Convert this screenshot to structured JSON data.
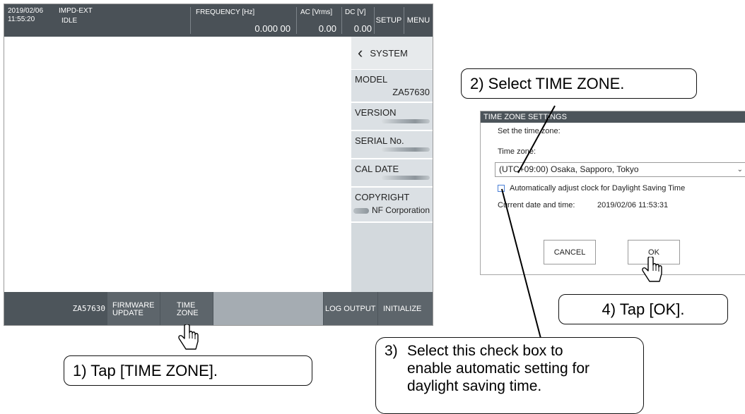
{
  "topbar": {
    "date": "2019/02/06",
    "time": "11:55:20",
    "mode": "IMPD-EXT",
    "status": "IDLE",
    "frequency_label": "FREQUENCY [Hz]",
    "frequency_value": "0.000 00",
    "ac_label": "AC [Vrms]",
    "ac_value": "0.00",
    "dc_label": "DC [V]",
    "dc_value": "0.00",
    "setup_label": "SETUP",
    "menu_label": "MENU"
  },
  "sidebar": {
    "back_icon": "‹",
    "title": "SYSTEM",
    "model_label": "MODEL",
    "model_value": "ZA57630",
    "version_label": "VERSION",
    "serial_label": "SERIAL No.",
    "cal_date_label": "CAL DATE",
    "copyright_label": "COPYRIGHT",
    "copyright_value": "NF Corporation"
  },
  "bottombar": {
    "model": "ZA57630",
    "firmware_update_l1": "FIRMWARE",
    "firmware_update_l2": "UPDATE",
    "time_zone_l1": "TIME",
    "time_zone_l2": "ZONE",
    "log_output": "LOG OUTPUT",
    "initialize": "INITIALIZE"
  },
  "dialog": {
    "title": "TIME ZONE SETTINGS",
    "prompt": "Set the time zone:",
    "tz_label": "Time zone:",
    "tz_selected": "(UTC+09:00) Osaka, Sapporo, Tokyo",
    "tz_chevron": "⌄",
    "dst_label": "Automatically adjust clock for Daylight Saving Time",
    "current_label": "Current date and time:",
    "current_value": "2019/02/06 11:53:31",
    "cancel": "CANCEL",
    "ok": "OK"
  },
  "callouts": {
    "step1": "1) Tap [TIME ZONE].",
    "step2": "2) Select TIME ZONE.",
    "step3_num": "3)",
    "step3_l1": "Select this check box to",
    "step3_l2": "enable automatic setting for",
    "step3_l3": "daylight saving time.",
    "step4": "4) Tap [OK]."
  }
}
